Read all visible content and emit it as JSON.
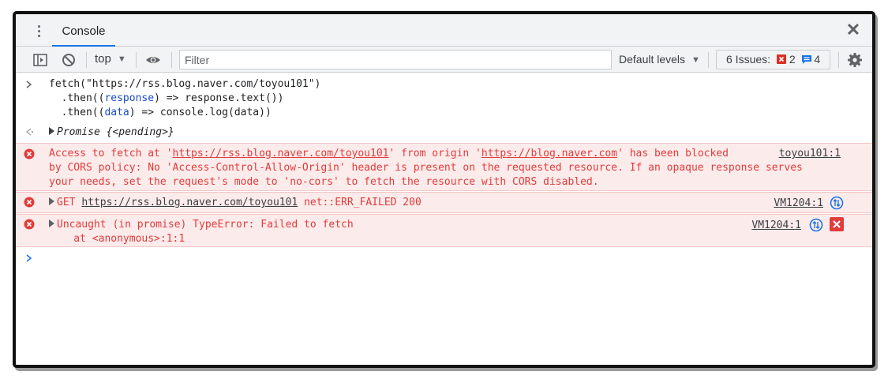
{
  "tabbar": {
    "menu_icon": "kebab-icon",
    "tab_label": "Console",
    "close_icon": "close-icon"
  },
  "toolbar": {
    "context": "top",
    "filter_placeholder": "Filter",
    "levels": "Default levels",
    "issues_label": "6 Issues:",
    "issues_errors": "2",
    "issues_info": "4"
  },
  "console": {
    "input_lines": [
      "fetch(\"https://rss.blog.naver.com/toyou101\")",
      "  .then((response) => response.text())",
      "  .then((data) => console.log(data))"
    ],
    "promise_label": "Promise",
    "promise_state": "{<pending>}",
    "cors_error": {
      "line1_a": "Access to fetch at '",
      "line1_link1": "https://rss.blog.naver.com/toyou101",
      "line1_b": "' from origin '",
      "line1_link2": "https://blog.naver.com",
      "line1_c": "' has been blocked",
      "line2": "by CORS policy: No 'Access-Control-Allow-Origin' header is present on the requested resource. If an opaque response serves",
      "line3": "your needs, set the request's mode to 'no-cors' to fetch the resource with CORS disabled.",
      "source": "toyou101:1"
    },
    "get_error": {
      "method": "GET",
      "url": "https://rss.blog.naver.com/toyou101",
      "status": "net::ERR_FAILED 200",
      "source": "VM1204:1"
    },
    "type_error": {
      "line1": "Uncaught (in promise) TypeError: Failed to fetch",
      "line2": "    at <anonymous>:1:1",
      "source": "VM1204:1"
    }
  },
  "colors": {
    "error_text": "#e23b3b",
    "error_bg": "#fcebeb",
    "accent": "#1a73e8"
  }
}
